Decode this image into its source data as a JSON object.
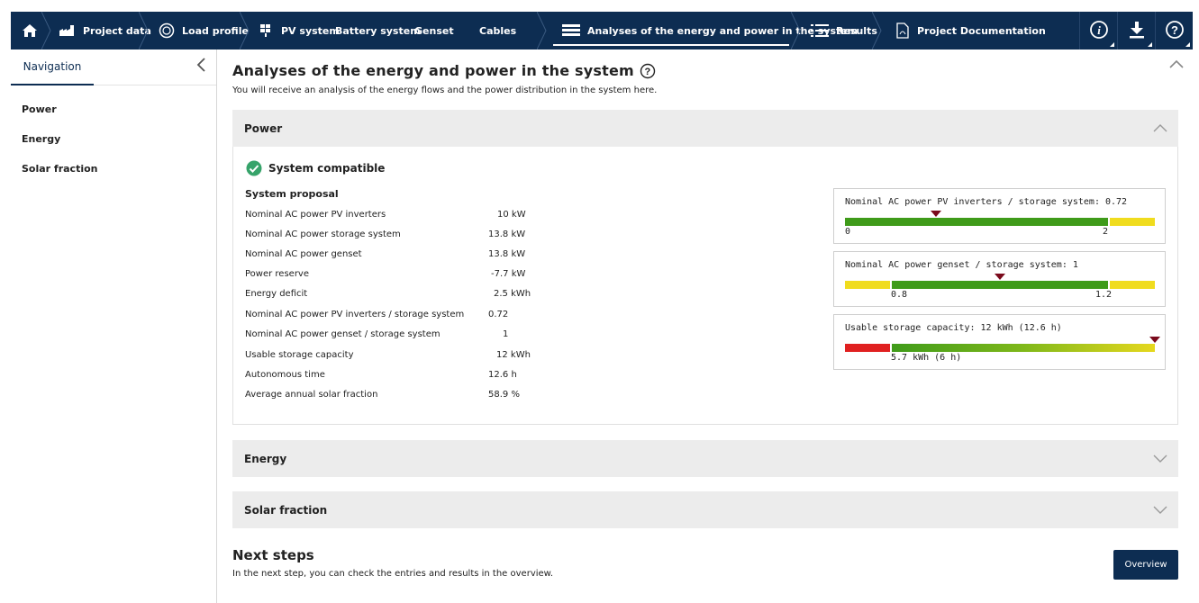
{
  "topnav": {
    "items": [
      {
        "label": ""
      },
      {
        "label": "Project data"
      },
      {
        "label": "Load profile"
      },
      {
        "label": "PV system"
      },
      {
        "label": "Battery system"
      },
      {
        "label": "Genset"
      },
      {
        "label": "Cables"
      },
      {
        "label": "Analyses of the energy and power in the system"
      },
      {
        "label": "Results"
      },
      {
        "label": "Project Documentation"
      }
    ],
    "active_index": 7,
    "icons": [
      "home-icon",
      "factory-icon",
      "load-profile-icon",
      "pv-panel-icon",
      "analysis-icon",
      "list-icon",
      "pdf-icon",
      "info-icon",
      "download-icon",
      "help-icon"
    ]
  },
  "sidebar": {
    "title": "Navigation",
    "items": [
      {
        "label": "Power"
      },
      {
        "label": "Energy"
      },
      {
        "label": "Solar fraction"
      }
    ]
  },
  "page": {
    "title": "Analyses of the energy and power in the system",
    "subtitle": "You will receive an analysis of the energy flows and the power distribution in the system here."
  },
  "power_section": {
    "header": "Power",
    "status": "System compatible",
    "proposal_title": "System proposal",
    "rows": [
      {
        "label": "Nominal AC power PV inverters",
        "value": "10 kW"
      },
      {
        "label": "Nominal AC power storage system",
        "value": "13.8 kW"
      },
      {
        "label": "Nominal AC power genset",
        "value": "13.8 kW"
      },
      {
        "label": "Power reserve",
        "value": "-7.7 kW"
      },
      {
        "label": "Energy deficit",
        "value": "2.5 kWh"
      },
      {
        "label": "Nominal AC power PV inverters / storage system",
        "value": "0.72"
      },
      {
        "label": "Nominal AC power genset / storage system",
        "value": "1"
      },
      {
        "label": "Usable storage capacity",
        "value": "12 kWh"
      },
      {
        "label": "Autonomous time",
        "value": "12.6 h"
      },
      {
        "label": "Average annual solar fraction",
        "value": "58.9 %"
      }
    ],
    "gauges": [
      {
        "title": "Nominal AC power PV inverters / storage system: 0.72",
        "labels": [
          "0",
          "2"
        ],
        "marker_value": 0.72
      },
      {
        "title": "Nominal AC power genset / storage system: 1",
        "labels": [
          "0.8",
          "1.2"
        ],
        "marker_value": 1
      },
      {
        "title": "Usable storage capacity: 12 kWh (12.6 h)",
        "labels": [
          "5.7 kWh (6 h)"
        ],
        "marker_value": 12
      }
    ],
    "colors": {
      "green": "#3f9b1a",
      "yellow": "#f0dc1e",
      "red": "#e02020",
      "marker": "#7a0a1c"
    }
  },
  "energy_section": {
    "header": "Energy"
  },
  "solar_section": {
    "header": "Solar fraction"
  },
  "next_steps": {
    "title": "Next steps",
    "text": "In the next step, you can check the entries and results in the overview.",
    "button": "Overview"
  }
}
